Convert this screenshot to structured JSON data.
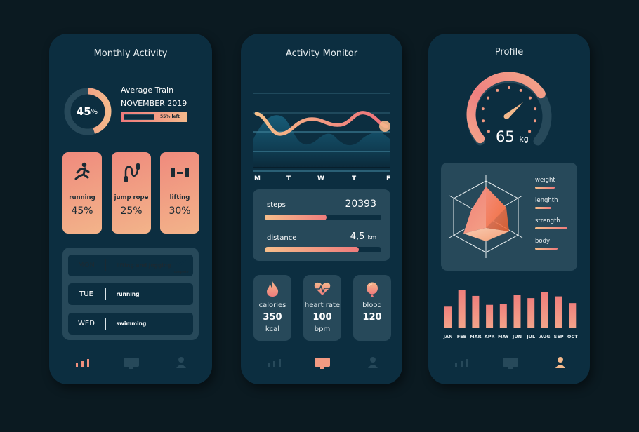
{
  "colors": {
    "background": "#0b1a21",
    "phone": "#0c2e40",
    "card": "#27495a",
    "accent_start": "#f0797b",
    "accent_end": "#f4b98c",
    "muted": "#27495a"
  },
  "phone1": {
    "title": "Monthly Activity",
    "donut": {
      "value_number": "45",
      "value_unit": "%",
      "progress_fraction": 0.45
    },
    "average": {
      "label": "Average Train",
      "period": "NOVEMBER 2019",
      "left_label": "55% left",
      "progress_fraction": 0.55
    },
    "tiles": [
      {
        "icon": "running-icon",
        "label": "running",
        "value": "45%"
      },
      {
        "icon": "jump-rope-icon",
        "label": "jump rope",
        "value": "25%"
      },
      {
        "icon": "dumbbell-icon",
        "label": "lifting",
        "value": "30%"
      }
    ],
    "schedule": [
      {
        "day": "MON",
        "activity": "lifting and jogging",
        "status": "complete",
        "active": true
      },
      {
        "day": "TUE",
        "activity": "running",
        "status": "",
        "active": false
      },
      {
        "day": "WED",
        "activity": "swimming",
        "status": "",
        "active": false
      }
    ],
    "nav_active": "stats"
  },
  "phone2": {
    "title": "Activity Monitor",
    "chart_days": [
      "M",
      "T",
      "W",
      "T",
      "F"
    ],
    "steps": {
      "label": "steps",
      "value": "20393",
      "progress_fraction": 0.53
    },
    "distance": {
      "label": "distance",
      "value": "4,5",
      "unit": "km",
      "progress_fraction": 0.81
    },
    "stats": [
      {
        "icon": "flame-icon",
        "label": "calories",
        "value": "350",
        "unit": "kcal"
      },
      {
        "icon": "heart-rate-icon",
        "label": "heart rate",
        "value": "100",
        "unit": "bpm"
      },
      {
        "icon": "blood-drop-icon",
        "label": "blood",
        "value": "120",
        "unit": ""
      }
    ],
    "nav_active": "monitor"
  },
  "phone3": {
    "title": "Profile",
    "gauge": {
      "value": "65",
      "unit": "kg",
      "fill_fraction": 0.72
    },
    "radar_legend": [
      {
        "label": "weight",
        "value_fraction": 0.6
      },
      {
        "label": "lenghth",
        "value_fraction": 0.5
      },
      {
        "label": "strength",
        "value_fraction": 1.0
      },
      {
        "label": "body",
        "value_fraction": 0.7
      }
    ],
    "chart_data": {
      "type": "bar",
      "title": "",
      "categories": [
        "JAN",
        "FEB",
        "MAR",
        "APR",
        "MAY",
        "JUN",
        "JUL",
        "AUG",
        "SEP",
        "OCT"
      ],
      "values": [
        48,
        85,
        72,
        52,
        54,
        74,
        67,
        80,
        71,
        56
      ],
      "ylim": [
        0,
        100
      ]
    },
    "nav_active": "profile"
  }
}
